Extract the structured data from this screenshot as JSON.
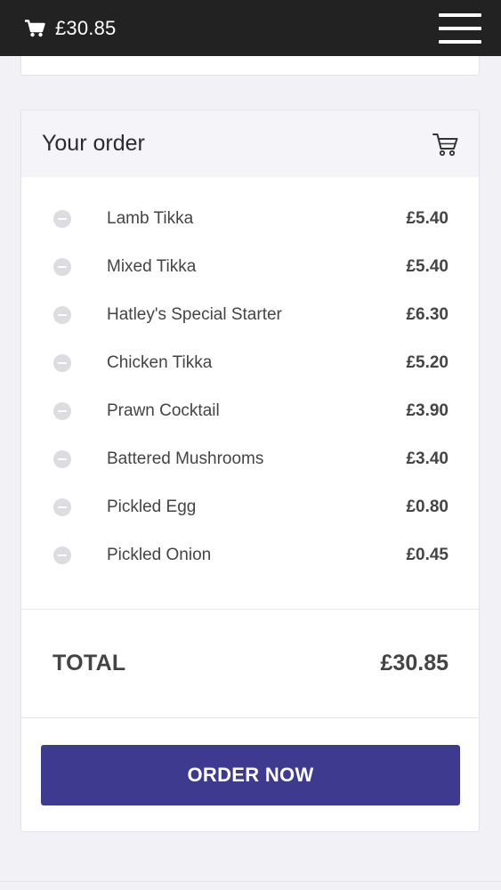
{
  "header": {
    "cart_amount": "£30.85",
    "cart_icon": "shopping-cart-icon",
    "menu_icon": "hamburger-menu-icon"
  },
  "order": {
    "title": "Your order",
    "title_icon": "basket-cart-icon",
    "items": [
      {
        "name": "Lamb Tikka",
        "price": "£5.40"
      },
      {
        "name": "Mixed Tikka",
        "price": "£5.40"
      },
      {
        "name": "Hatley's Special Starter",
        "price": "£6.30"
      },
      {
        "name": "Chicken Tikka",
        "price": "£5.20"
      },
      {
        "name": "Prawn Cocktail",
        "price": "£3.90"
      },
      {
        "name": "Battered Mushrooms",
        "price": "£3.40"
      },
      {
        "name": "Pickled Egg",
        "price": "£0.80"
      },
      {
        "name": "Pickled Onion",
        "price": "£0.45"
      }
    ],
    "total_label": "TOTAL",
    "total_value": "£30.85",
    "order_button_label": "ORDER NOW"
  },
  "colors": {
    "topbar": "#222222",
    "accent_button": "#3e3a8f",
    "background": "#f2f1f5"
  }
}
